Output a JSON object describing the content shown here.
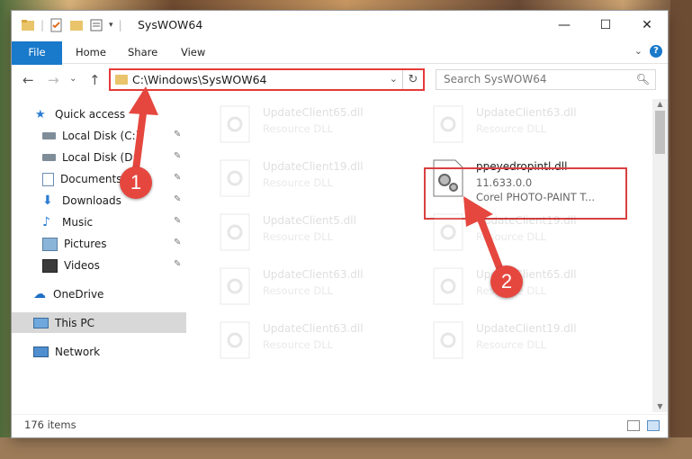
{
  "window": {
    "title": "SysWOW64",
    "controls": {
      "minimize": "—",
      "maximize": "☐",
      "close": "✕"
    }
  },
  "ribbon": {
    "tabs": [
      "File",
      "Home",
      "Share",
      "View"
    ],
    "expand_icon": "chevron-down-icon",
    "help_label": "?"
  },
  "navbar": {
    "back": "←",
    "forward": "→",
    "recent": "⌄",
    "up": "↑",
    "address": "C:\\Windows\\SysWOW64",
    "refresh": "↻",
    "search_placeholder": "Search SysWOW64"
  },
  "sidebar": {
    "items": [
      {
        "label": "Quick access",
        "icon": "star-icon",
        "pinned": false
      },
      {
        "label": "Local Disk (C:)",
        "icon": "drive-icon",
        "pinned": true
      },
      {
        "label": "Local Disk (D:)",
        "icon": "drive-icon",
        "pinned": true
      },
      {
        "label": "Documents",
        "icon": "documents-icon",
        "pinned": true
      },
      {
        "label": "Downloads",
        "icon": "download-icon",
        "pinned": true
      },
      {
        "label": "Music",
        "icon": "music-icon",
        "pinned": true
      },
      {
        "label": "Pictures",
        "icon": "pictures-icon",
        "pinned": true
      },
      {
        "label": "Videos",
        "icon": "videos-icon",
        "pinned": true
      },
      {
        "label": "OneDrive",
        "icon": "cloud-icon",
        "pinned": false
      },
      {
        "label": "This PC",
        "icon": "computer-icon",
        "pinned": false,
        "selected": true
      },
      {
        "label": "Network",
        "icon": "network-icon",
        "pinned": false
      }
    ],
    "pin_glyph": "📌"
  },
  "files": [
    {
      "name": "UpdateClient65.dll",
      "type": "Resource DLL",
      "faded": true
    },
    {
      "name": "UpdateClient63.dll",
      "type": "Resource DLL",
      "faded": true
    },
    {
      "name": "UpdateClient19.dll",
      "type": "Resource DLL",
      "faded": true
    },
    {
      "name": "ppeyedropintl.dll",
      "version": "11.633.0.0",
      "type": "Corel PHOTO-PAINT T...",
      "faded": false,
      "highlighted": true
    },
    {
      "name": "UpdateClient5.dll",
      "type": "Resource DLL",
      "faded": true
    },
    {
      "name": "UpdateClient19.dll",
      "type": "Resource DLL",
      "faded": true
    },
    {
      "name": "UpdateClient63.dll",
      "type": "Resource DLL",
      "faded": true
    },
    {
      "name": "UpdateClient65.dll",
      "type": "Resource DLL",
      "faded": true
    },
    {
      "name": "UpdateClient63.dll",
      "type": "Resource DLL",
      "faded": true
    },
    {
      "name": "UpdateClient19.dll",
      "type": "Resource DLL",
      "faded": true
    }
  ],
  "status": {
    "item_count": "176 items"
  },
  "annotations": {
    "step1": "1",
    "step2": "2"
  },
  "colors": {
    "accent": "#1979ca",
    "highlight": "#e5473f",
    "selected": "#d8d8d8"
  }
}
